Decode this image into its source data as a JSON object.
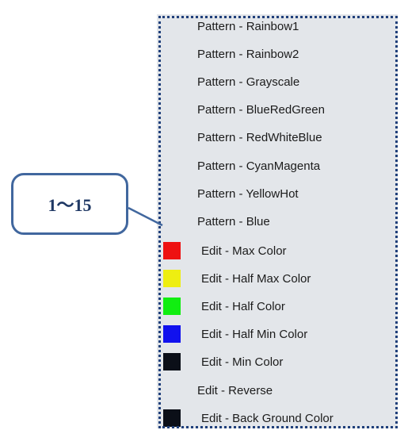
{
  "callout": {
    "text": "1～15",
    "border_color": "#41679e",
    "text_color": "#1f3864"
  },
  "menu": {
    "background": "#e3e6ea",
    "outline_color": "#1f3f7a",
    "items": [
      {
        "label": "Pattern - Rainbow1",
        "swatch": null
      },
      {
        "label": "Pattern - Rainbow2",
        "swatch": null
      },
      {
        "label": "Pattern - Grayscale",
        "swatch": null
      },
      {
        "label": "Pattern - BlueRedGreen",
        "swatch": null
      },
      {
        "label": "Pattern - RedWhiteBlue",
        "swatch": null
      },
      {
        "label": "Pattern - CyanMagenta",
        "swatch": null
      },
      {
        "label": "Pattern - YellowHot",
        "swatch": null
      },
      {
        "label": "Pattern - Blue",
        "swatch": null
      },
      {
        "label": "Edit - Max Color",
        "swatch": "#ee1111"
      },
      {
        "label": "Edit - Half Max Color",
        "swatch": "#eeee11"
      },
      {
        "label": "Edit - Half Color",
        "swatch": "#11ee11"
      },
      {
        "label": "Edit - Half Min Color",
        "swatch": "#1111ee"
      },
      {
        "label": "Edit - Min Color",
        "swatch": "#0b0f18"
      },
      {
        "label": "Edit - Reverse",
        "swatch": null
      },
      {
        "label": "Edit - Back Ground Color",
        "swatch": "#0b0f18"
      }
    ]
  }
}
